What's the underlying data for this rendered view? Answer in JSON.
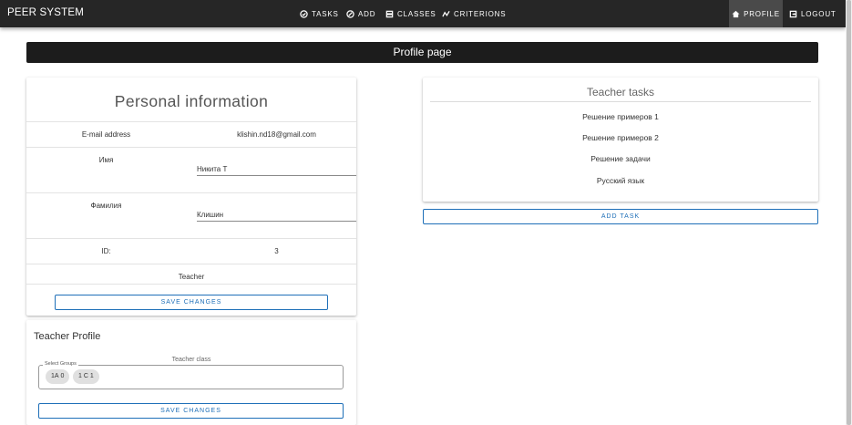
{
  "app": {
    "brand": "PEER SYSTEM"
  },
  "nav": {
    "tasks": "TASKS",
    "add": "ADD",
    "classes": "CLASSES",
    "criterions": "CRITERIONS",
    "profile": "PROFILE",
    "logout": "LOGOUT",
    "active": "profile"
  },
  "page": {
    "title": "Profile page"
  },
  "personal": {
    "title": "Personal information",
    "email_label": "E-mail address",
    "email_value": "klishin.nd18@gmail.com",
    "first_name_label": "Имя",
    "first_name_value": "Никита Т",
    "last_name_label": "Фамилия",
    "last_name_value": "Клишин",
    "id_label": "ID:",
    "id_value": "3",
    "role": "Teacher",
    "save_label": "SAVE CHANGES"
  },
  "teacher_tasks": {
    "title": "Teacher tasks",
    "items": [
      "Решение примеров 1",
      "Решение примеров 2",
      "Решение задачи",
      "Русский язык"
    ],
    "add_task_label": "ADD TASK"
  },
  "teacher_profile": {
    "title": "Teacher Profile",
    "class_label": "Teacher class",
    "groups_legend": "Select Groups",
    "chips": [
      "1А 0",
      "1 С 1"
    ],
    "save_label": "SAVE CHANGES"
  },
  "colors": {
    "appbar": "#262626",
    "accent": "#1e6fb8",
    "titlebar": "#1c1c1c"
  }
}
